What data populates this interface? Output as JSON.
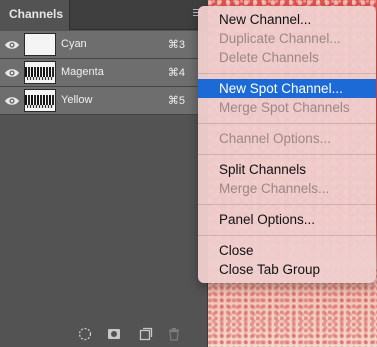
{
  "panel": {
    "tab_label": "Channels",
    "channels": [
      {
        "name": "Cyan",
        "shortcut": "⌘3"
      },
      {
        "name": "Magenta",
        "shortcut": "⌘4"
      },
      {
        "name": "Yellow",
        "shortcut": "⌘5"
      }
    ],
    "toolbar_icons": [
      "load-selection-icon",
      "save-selection-icon",
      "new-channel-icon",
      "trash-icon"
    ]
  },
  "menu": {
    "items": {
      "new_channel": "New Channel...",
      "duplicate_channel": "Duplicate Channel...",
      "delete_channels": "Delete Channels",
      "new_spot_channel": "New Spot Channel...",
      "merge_spot_channels": "Merge Spot Channels",
      "channel_options": "Channel Options...",
      "split_channels": "Split Channels",
      "merge_channels": "Merge Channels...",
      "panel_options": "Panel Options...",
      "close": "Close",
      "close_tab_group": "Close Tab Group"
    },
    "highlighted": "New Spot Channel..."
  },
  "colors": {
    "panel_bg": "#535353",
    "row_bg": "#6e6e6e",
    "menu_bg": "#eecdcd",
    "highlight": "#1b6ad6",
    "canvas_red": "#d84a46"
  }
}
